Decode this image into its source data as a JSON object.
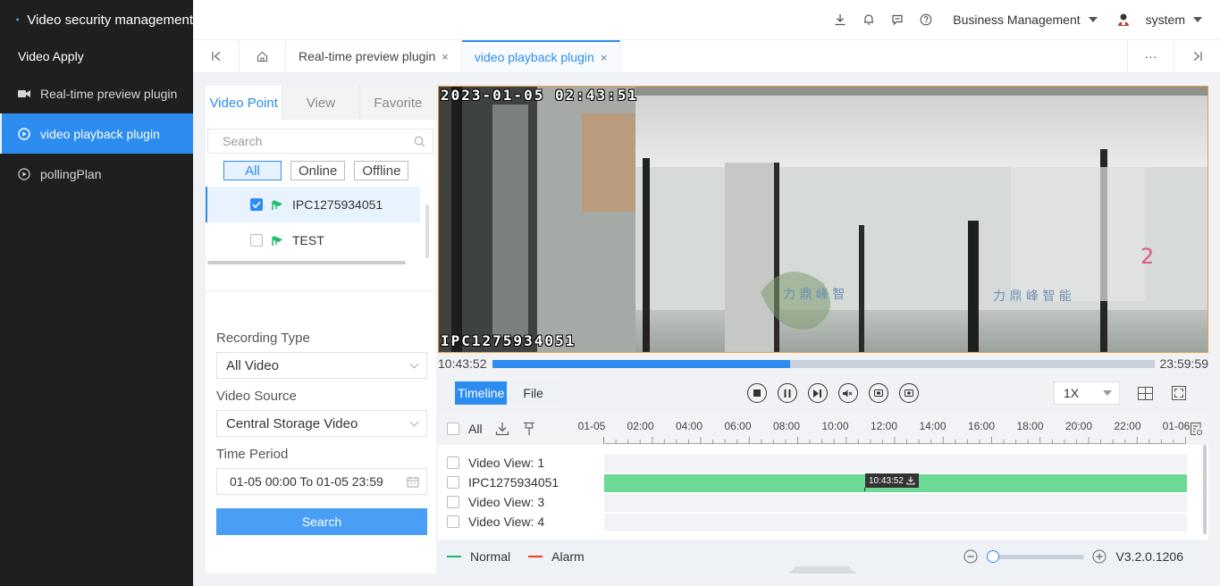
{
  "app": {
    "title": "Video security management"
  },
  "sidebar": {
    "group_title": "Video Apply",
    "items": [
      {
        "label": "Real-time preview plugin",
        "icon": "camera-icon",
        "active": false
      },
      {
        "label": "video playback plugin",
        "icon": "playback-icon",
        "active": true
      },
      {
        "label": "pollingPlan",
        "icon": "play-circle-icon",
        "active": false
      }
    ]
  },
  "header": {
    "org_select": "Business Management",
    "user": "system",
    "icons": [
      "download-icon",
      "bell-icon",
      "message-icon",
      "help-icon"
    ]
  },
  "tabs": [
    {
      "label": "Real-time preview plugin",
      "close": "×",
      "active": false
    },
    {
      "label": "video playback plugin",
      "close": "×",
      "active": true
    }
  ],
  "tabs_more": "···",
  "left_panel": {
    "tabs": [
      "Video Point",
      "View",
      "Favorite"
    ],
    "search_placeholder": "Search",
    "filters": [
      "All",
      "Online",
      "Offline"
    ],
    "devices": [
      {
        "name": "IPC1275934051",
        "checked": true
      },
      {
        "name": "TEST",
        "checked": false
      }
    ],
    "recording_type_label": "Recording Type",
    "recording_type_value": "All Video",
    "video_source_label": "Video Source",
    "video_source_value": "Central Storage Video",
    "time_period_label": "Time Period",
    "time_period_value": "01-05 00:00 To 01-05 23:59",
    "search_button": "Search"
  },
  "video": {
    "timestamp_osd": "2023-01-05  02:43:51",
    "camera_osd": "IPC1275934051"
  },
  "progress": {
    "start": "10:43:52",
    "end": "23:59:59",
    "fraction": 0.45
  },
  "controls": {
    "view_modes": [
      "Timeline",
      "File"
    ],
    "speed": "1X"
  },
  "timeline": {
    "all_label": "All",
    "ticks": [
      "01-05",
      "02:00",
      "04:00",
      "06:00",
      "08:00",
      "10:00",
      "12:00",
      "14:00",
      "16:00",
      "18:00",
      "20:00",
      "22:00",
      "01-06"
    ],
    "rows": [
      {
        "label": "Video View:  1",
        "has_record": false
      },
      {
        "label": "IPC1275934051",
        "has_record": true
      },
      {
        "label": "Video View:  3",
        "has_record": false
      },
      {
        "label": "Video View:  4",
        "has_record": false
      }
    ],
    "marker_time": "10:43:52",
    "legend": [
      {
        "label": "Normal",
        "color": "#19be6b"
      },
      {
        "label": "Alarm",
        "color": "#ed4014"
      }
    ],
    "version": "V3.2.0.1206"
  }
}
